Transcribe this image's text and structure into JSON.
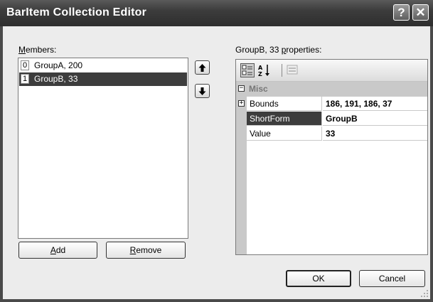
{
  "window": {
    "title": "BarItem Collection Editor",
    "help_glyph": "?",
    "close_glyph": "✕"
  },
  "members": {
    "label_accel": "M",
    "label_rest": "embers:",
    "items": [
      {
        "index": "0",
        "text": "GroupA, 200",
        "selected": false
      },
      {
        "index": "1",
        "text": "GroupB, 33",
        "selected": true
      }
    ]
  },
  "move": {
    "up_glyph": "🡅",
    "down_glyph": "🡇"
  },
  "buttons": {
    "add_accel": "A",
    "add_rest": "dd",
    "remove_accel": "R",
    "remove_rest": "emove",
    "ok": "OK",
    "cancel": "Cancel"
  },
  "properties": {
    "header_pre": "GroupB, 33 ",
    "header_accel": "p",
    "header_post": "roperties:",
    "toolbar_icons": [
      "categorized-icon",
      "alphabetical-icon",
      "property-pages-icon"
    ],
    "category": {
      "name": "Misc",
      "toggle": "⊟"
    },
    "rows": [
      {
        "name": "Bounds",
        "value": "186, 191, 186, 37",
        "expander": "+"
      },
      {
        "name": "ShortForm",
        "value": "GroupB",
        "expander": ""
      },
      {
        "name": "Value",
        "value": "33",
        "expander": ""
      }
    ]
  },
  "colors": {
    "selection": "#3d3d3d",
    "titlebar": "#3c3c3c",
    "dialog_face": "#ececec"
  }
}
